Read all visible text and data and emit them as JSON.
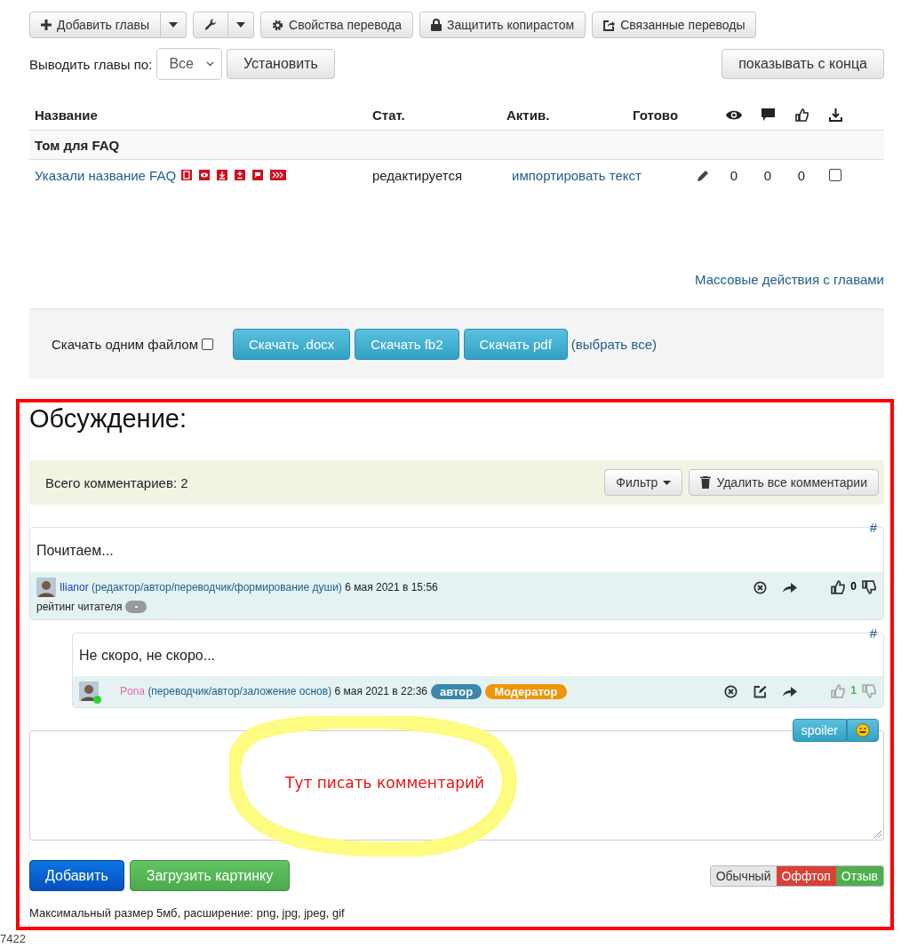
{
  "toolbar": {
    "buttons": [
      {
        "kind": "add",
        "label": "Добавить главы"
      },
      {
        "kind": "tools"
      },
      {
        "kind": "gear",
        "label": "Свойства перевода"
      },
      {
        "kind": "lock",
        "label": "Защитить копирастом"
      },
      {
        "kind": "share",
        "label": "Связанные переводы"
      }
    ]
  },
  "paging": {
    "label": "Выводить главы по:",
    "select": "Все",
    "apply": "Установить",
    "reverse": "показывать с конца"
  },
  "table": {
    "columns": [
      "Название",
      "Стат.",
      "Актив.",
      "Готово"
    ],
    "group": "Том для FAQ",
    "rows": [
      {
        "title": "Указали название FAQ",
        "status": "редактируется",
        "action": "импортировать текст",
        "views": "0",
        "comments": "0",
        "likes": "0",
        "checked": false
      }
    ]
  },
  "mass_link": "Массовые действия с главами",
  "download": {
    "label": "Скачать одним файлом",
    "checked": false,
    "buttons": [
      "Скачать .docx",
      "Скачать fb2",
      "Скачать pdf"
    ],
    "select_all": "(выбрать все)"
  },
  "discussion": {
    "title": "Обсуждение:",
    "total": "Всего комментариев: 2",
    "filter": "Фильтр",
    "delete_all": "Удалить все комментарии",
    "comments": [
      {
        "permalink": "#",
        "text": "Почитаем...",
        "author": {
          "name": "Ilianor",
          "color": "#1a3ccc"
        },
        "roles": "(редактор/автор/переводчик/формирование души)",
        "date": "6 мая 2021 в 15:56",
        "online": false,
        "editable": false,
        "score": {
          "value": "0",
          "color": "#000000"
        },
        "rating_label": "рейтинг читателя",
        "rating": "-",
        "reply": false
      },
      {
        "permalink": "#",
        "text": "Не скоро, не скоро...",
        "author": {
          "name": "Pona",
          "color": "#e86aa8"
        },
        "roles": "(переводчик/автор/заложение основ)",
        "date": "6 мая 2021 в 22:36",
        "online": true,
        "editable": true,
        "score": {
          "value": "1",
          "color": "#4caf50"
        },
        "badges": [
          {
            "label": "автор",
            "color": "#3b87ad"
          },
          {
            "label": "Модератор",
            "color": "#f0940a"
          }
        ],
        "reply": true
      }
    ],
    "spoiler": "spoiler",
    "annotation": "Тут писать комментарий",
    "add": "Добавить",
    "upload": "Загрузить картинку",
    "types": [
      {
        "label": "Обычный",
        "color": "#e6e6e6"
      },
      {
        "label": "Оффтоп",
        "color": "#d9403a"
      },
      {
        "label": "Отзыв",
        "color": "#4fae4f"
      }
    ],
    "hint": "Максимальный размер 5мб, расширение: png, jpg, jpeg, gif"
  },
  "footer_text": "7422"
}
